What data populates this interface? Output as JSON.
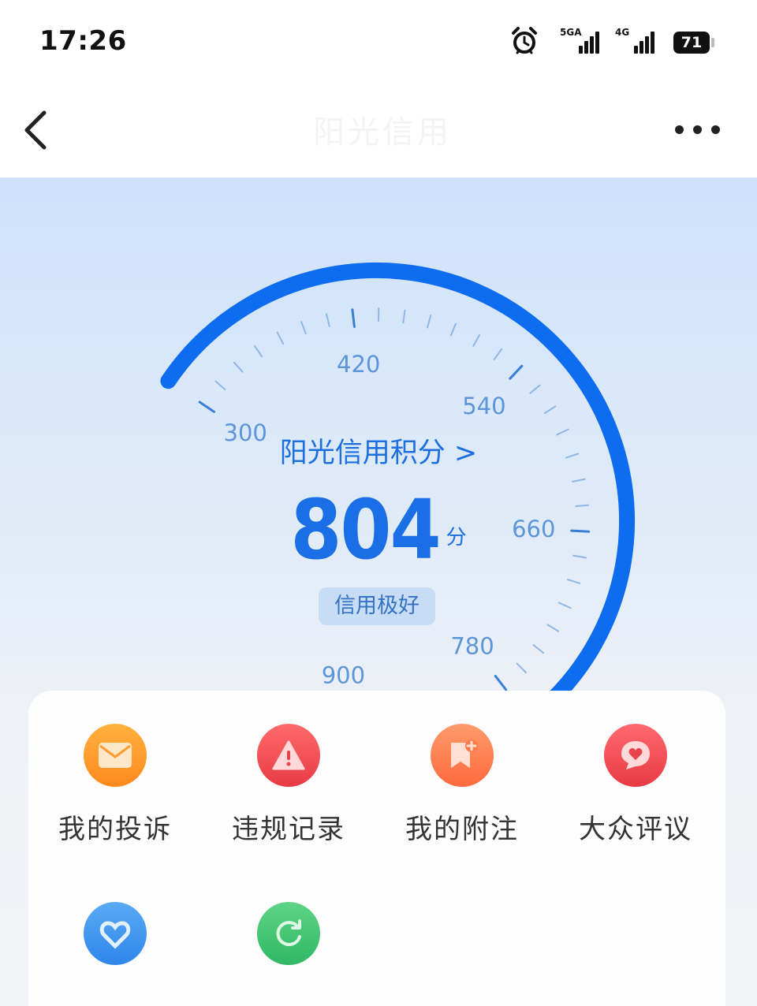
{
  "status_bar": {
    "time": "17:26",
    "network_1": "5GA",
    "network_2": "4G",
    "battery": "71"
  },
  "nav": {
    "title": "阳光信用",
    "back_icon": "chevron-left-icon",
    "more_icon": "more-dots-icon"
  },
  "gauge": {
    "min": 300,
    "max": 900,
    "value": 804,
    "tick_labels": [
      "300",
      "420",
      "540",
      "660",
      "780",
      "900"
    ],
    "title": "阳光信用积分 >",
    "score": "804",
    "unit": "分",
    "level": "信用极好",
    "colors": {
      "arc_active": "#0d6cf0",
      "arc_track": "#cfe0f6",
      "tick": "#8fb7e6"
    }
  },
  "services": [
    {
      "label": "我的投诉",
      "icon": "mail-icon",
      "color": "#ff9626"
    },
    {
      "label": "违规记录",
      "icon": "warning-icon",
      "color": "#f2484d"
    },
    {
      "label": "我的附注",
      "icon": "bookmark-plus-icon",
      "color": "#ff7a4a"
    },
    {
      "label": "大众评议",
      "icon": "heart-chat-icon",
      "color": "#f2474f"
    },
    {
      "label": "",
      "icon": "heart-icon",
      "color": "#3b93ee"
    },
    {
      "label": "",
      "icon": "refresh-icon",
      "color": "#39c06a"
    }
  ]
}
